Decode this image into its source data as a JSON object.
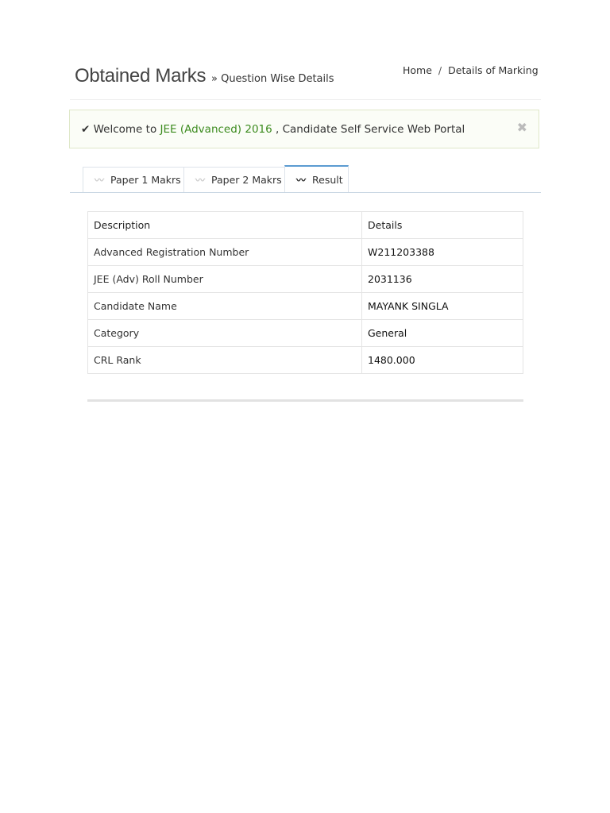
{
  "header": {
    "title": "Obtained Marks",
    "subtitle_icon": "double-chevron-right-icon",
    "subtitle": "» Question Wise Details"
  },
  "breadcrumb": {
    "home": "Home",
    "separator": "/",
    "current": "Details of Marking"
  },
  "alert": {
    "icon": "check-icon",
    "prefix": "Welcome to",
    "highlight": "JEE (Advanced) 2016",
    "suffix": ", Candidate Self Service Web Portal",
    "close": "✖"
  },
  "tabs": [
    {
      "label": "Paper 1 Makrs",
      "icon": "rss-icon"
    },
    {
      "label": "Paper 2 Makrs",
      "icon": "rss-icon"
    },
    {
      "label": "Result",
      "icon": "rss-icon",
      "active": true
    }
  ],
  "table": {
    "headers": [
      "Description",
      "Details"
    ],
    "rows": [
      [
        "Advanced Registration Number",
        "W211203388"
      ],
      [
        "JEE (Adv) Roll Number",
        "2031136"
      ],
      [
        "Candidate Name",
        "MAYANK SINGLA"
      ],
      [
        "Category",
        "General"
      ],
      [
        "CRL Rank",
        "1480.000"
      ]
    ]
  },
  "colors": {
    "highlight": "#3c8b1e",
    "link": "#2e75b6",
    "active_tab": "#5b9bd1"
  }
}
